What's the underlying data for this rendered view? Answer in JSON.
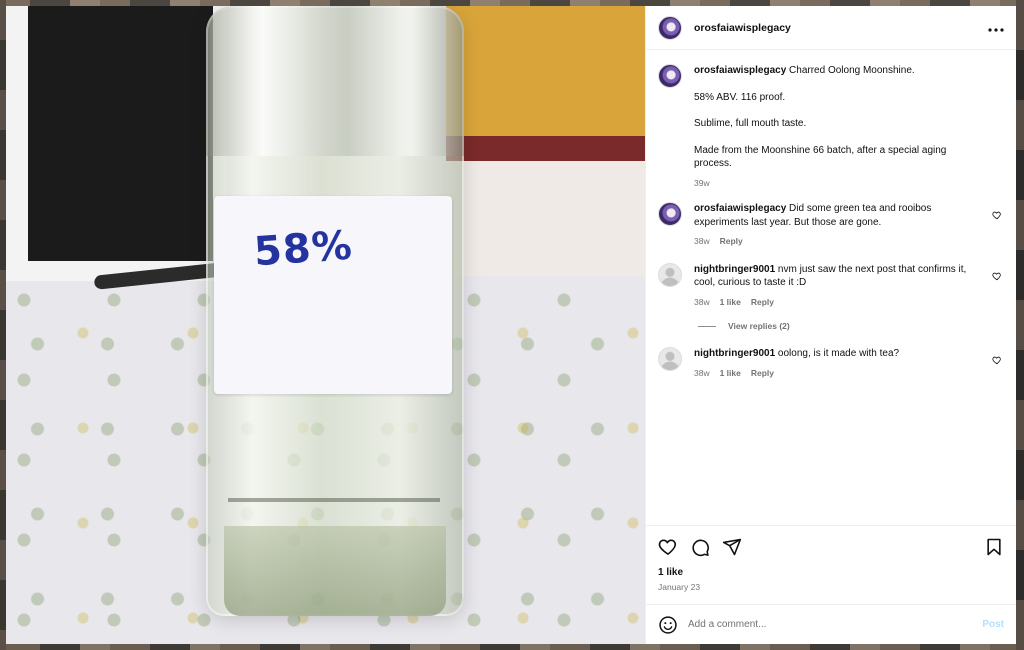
{
  "post": {
    "image_label_text": "58%",
    "author": "orosfaiawisplegacy",
    "more_icon": "more-horizontal-icon"
  },
  "caption": {
    "author": "orosfaiawisplegacy",
    "line1": "Charred Oolong Moonshine.",
    "line2": "58% ABV. 116 proof.",
    "line3": "Sublime, full mouth taste.",
    "line4": "Made from the Moonshine 66 batch, after a special aging process.",
    "time": "39w"
  },
  "comments": [
    {
      "author": "orosfaiawisplegacy",
      "text": "Did some green tea and rooibos experiments last year. But those are gone.",
      "time": "38w",
      "likes": "",
      "reply": "Reply"
    },
    {
      "author": "nightbringer9001",
      "text": "nvm just saw the next post that confirms it, cool, curious to taste it :D",
      "time": "38w",
      "likes": "1 like",
      "reply": "Reply",
      "view_replies": "View replies (2)"
    },
    {
      "author": "nightbringer9001",
      "text": "oolong, is it made with tea?",
      "time": "38w",
      "likes": "1 like",
      "reply": "Reply"
    }
  ],
  "footer": {
    "likes": "1 like",
    "date": "January 23",
    "comment_placeholder": "Add a comment...",
    "post_label": "Post"
  },
  "colors": {
    "post_button_disabled": "#b2dffc",
    "meta_text": "#737373",
    "label_ink": "#2433a0"
  }
}
